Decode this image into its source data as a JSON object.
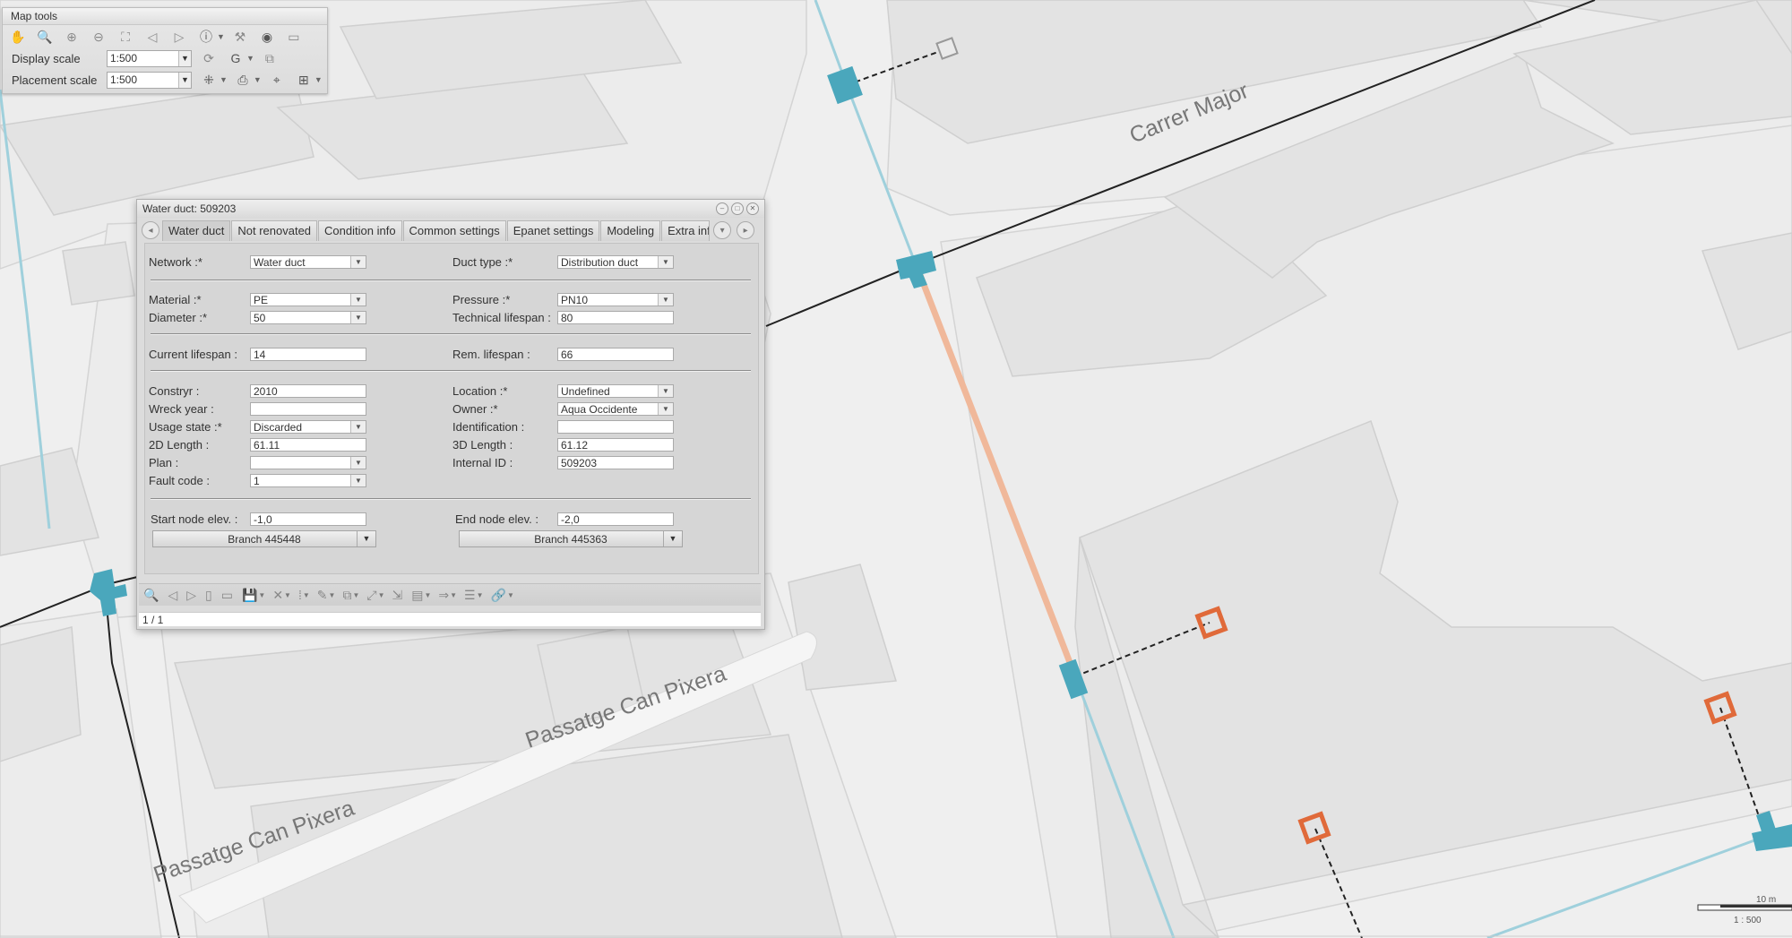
{
  "map": {
    "street_labels": [
      "Carrer Major",
      "Passatge Can Pixera",
      "Passatge Can Pixera"
    ],
    "scalebar": {
      "top": "10 m",
      "bottom": "1 : 500"
    },
    "colors": {
      "background": "#efefef",
      "building": "#e6e6e6",
      "building_edge": "#cfcfcf",
      "water_pipe": "#9fd0dc",
      "selected_pipe": "#f0b89a",
      "node": "#4aa7bc",
      "connection": "#e06a3a",
      "road_line": "#222222"
    }
  },
  "map_tools": {
    "title": "Map tools",
    "toolbar_icons": [
      "pan-icon",
      "zoom-in-icon",
      "zoom-area-icon",
      "zoom-out-icon",
      "zoom-extent-icon",
      "previous-extent-icon",
      "next-extent-icon",
      "info-icon",
      "measure-icon",
      "layers-icon",
      "window-icon"
    ],
    "display_scale_label": "Display scale",
    "display_scale_value": "1:500",
    "placement_scale_label": "Placement scale",
    "placement_scale_value": "1:500"
  },
  "dialog": {
    "title": "Water duct: 509203",
    "tabs": [
      "Water duct",
      "Not renovated",
      "Condition info",
      "Common settings",
      "Epanet settings",
      "Modeling",
      "Extra inf"
    ],
    "active_tab": "Water duct",
    "fields": {
      "network": {
        "label": "Network :*",
        "value": "Water duct"
      },
      "duct_type": {
        "label": "Duct type :*",
        "value": "Distribution duct"
      },
      "material": {
        "label": "Material :*",
        "value": "PE"
      },
      "pressure": {
        "label": "Pressure :*",
        "value": "PN10"
      },
      "diameter": {
        "label": "Diameter :*",
        "value": "50"
      },
      "technical_lifespan": {
        "label": "Technical lifespan :",
        "value": "80"
      },
      "current_lifespan": {
        "label": "Current lifespan :",
        "value": "14"
      },
      "rem_lifespan": {
        "label": "Rem. lifespan :",
        "value": "66"
      },
      "constryr": {
        "label": "Constryr :",
        "value": "2010"
      },
      "location": {
        "label": "Location :*",
        "value": "Undefined"
      },
      "wreck_year": {
        "label": "Wreck year :",
        "value": ""
      },
      "owner": {
        "label": "Owner :*",
        "value": "Aqua Occidente"
      },
      "usage_state": {
        "label": "Usage state :*",
        "value": "Discarded"
      },
      "identification": {
        "label": "Identification :",
        "value": ""
      },
      "length_2d": {
        "label": "2D Length :",
        "value": "61.11"
      },
      "length_3d": {
        "label": "3D Length :",
        "value": "61.12"
      },
      "plan": {
        "label": "Plan :",
        "value": ""
      },
      "internal_id": {
        "label": "Internal ID :",
        "value": "509203"
      },
      "fault_code": {
        "label": "Fault code :",
        "value": "1"
      },
      "start_node_elev": {
        "label": "Start node elev. :",
        "value": "-1,0"
      },
      "end_node_elev": {
        "label": "End node elev. :",
        "value": "-2,0"
      }
    },
    "start_branch": "Branch 445448",
    "end_branch": "Branch 445363",
    "status": "1 / 1"
  }
}
